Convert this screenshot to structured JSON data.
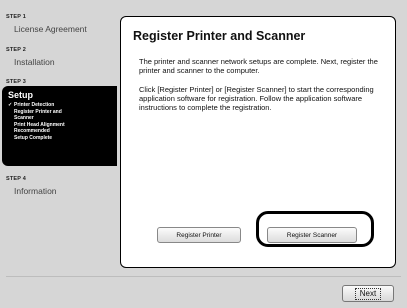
{
  "steps": [
    {
      "step_label": "STEP 1",
      "title": "License Agreement"
    },
    {
      "step_label": "STEP 2",
      "title": "Installation"
    },
    {
      "step_label": "STEP 3",
      "title": "Setup",
      "sub_items": [
        {
          "check": "✓",
          "label": "Printer Detection"
        },
        {
          "check": "",
          "label": "Register Printer and"
        },
        {
          "check": "",
          "label": "Scanner"
        },
        {
          "check": "",
          "label": "Print Head Alignment"
        },
        {
          "check": "",
          "label": "Recommended"
        },
        {
          "check": "",
          "label": "Setup Complete"
        }
      ]
    },
    {
      "step_label": "STEP 4",
      "title": "Information"
    }
  ],
  "content": {
    "title": "Register Printer and Scanner",
    "paragraph1": "The printer and scanner network setups are complete. Next, register the printer and scanner to the computer.",
    "paragraph2": "Click [Register Printer] or [Register Scanner] to start the corresponding application software for registration. Follow the application software instructions to complete the registration.",
    "register_printer_label": "Register Printer",
    "register_scanner_label": "Register Scanner"
  },
  "footer": {
    "next_label": "Next"
  }
}
